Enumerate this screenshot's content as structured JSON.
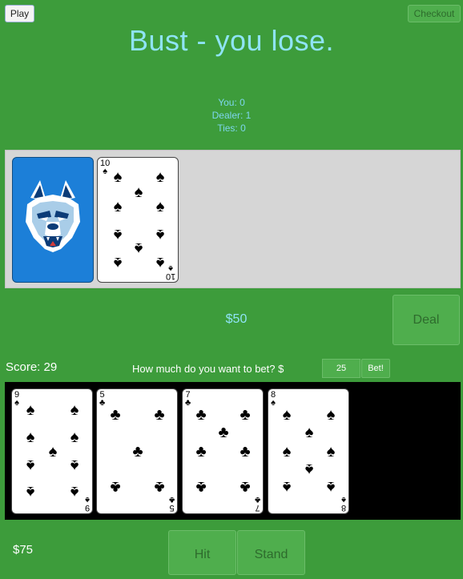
{
  "header": {
    "play_label": "Play",
    "checkout_label": "Checkout"
  },
  "status": {
    "message": "Bust - you lose."
  },
  "tally": {
    "you": "You: 0",
    "dealer": "Dealer: 1",
    "ties": "Ties: 0"
  },
  "dealer": {
    "money": "$50",
    "deal_label": "Deal",
    "cards": [
      {
        "face": "back",
        "icon": "wolf-mascot-card-back"
      },
      {
        "face": "up",
        "rank": "10",
        "suit": "♠",
        "suit_name": "spades"
      }
    ]
  },
  "player": {
    "score": "Score: 29",
    "bet_prompt": "How much do you want to bet?  $",
    "bet_value": "25",
    "bet_label": "Bet!",
    "money": "$75",
    "hit_label": "Hit",
    "stand_label": "Stand",
    "cards": [
      {
        "rank": "9",
        "suit": "♠",
        "suit_name": "spades"
      },
      {
        "rank": "5",
        "suit": "♣",
        "suit_name": "clubs"
      },
      {
        "rank": "7",
        "suit": "♣",
        "suit_name": "clubs"
      },
      {
        "rank": "8",
        "suit": "♠",
        "suit_name": "spades"
      }
    ]
  },
  "colors": {
    "felt": "#3d9c3b",
    "accent_text": "#8fe4f6",
    "card_back": "#1c7fd8"
  }
}
